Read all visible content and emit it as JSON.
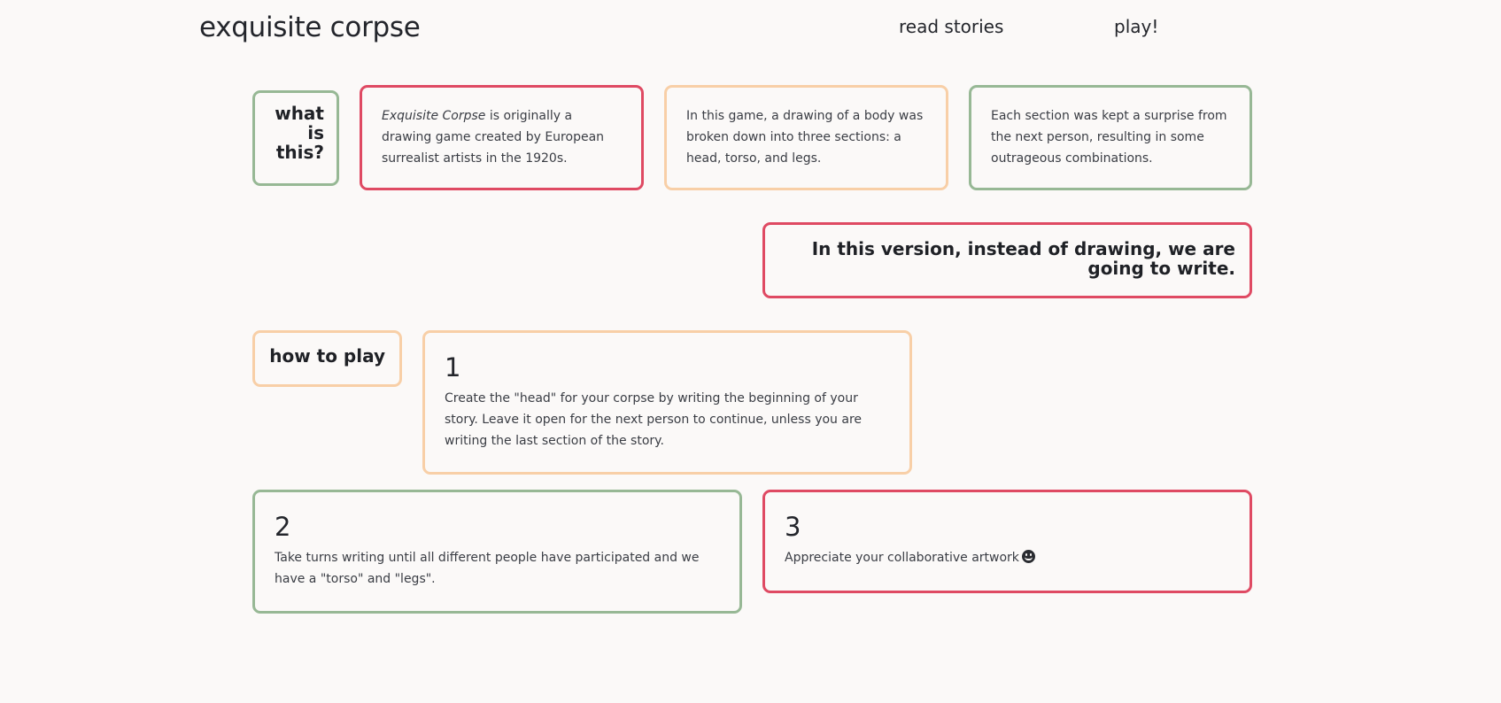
{
  "header": {
    "site_title": "exquisite corpse",
    "nav": {
      "read_stories": "read stories",
      "play": "play!"
    }
  },
  "intro": {
    "what_heading_lines": [
      "what",
      "is",
      "this?"
    ],
    "card1": {
      "emphasis": "Exquisite Corpse",
      "text": " is originally a drawing game created by European surrealist artists in the 1920s."
    },
    "card2": "In this game, a drawing of a body was broken down into three sections: a head, torso, and legs.",
    "card3": "Each section was kept a surprise from the next person, resulting in some outrageous combinations.",
    "version_statement": "In this version, instead of drawing, we are going to write."
  },
  "how_to_play": {
    "heading": "how to play",
    "steps": [
      {
        "number": "1",
        "text": "Create the \"head\" for your corpse by writing the beginning of your story. Leave it open for the next person to continue, unless you are writing the last section of the story."
      },
      {
        "number": "2",
        "text": "Take turns writing until all different people have participated and we have a \"torso\" and \"legs\"."
      },
      {
        "number": "3",
        "text": "Appreciate your collaborative artwork",
        "icon": "smiley-face-icon"
      }
    ]
  },
  "colors": {
    "green": "#97b895",
    "red": "#df4a63",
    "peach": "#f8cfa7",
    "background": "#fbf9f8",
    "text": "#23252b"
  }
}
